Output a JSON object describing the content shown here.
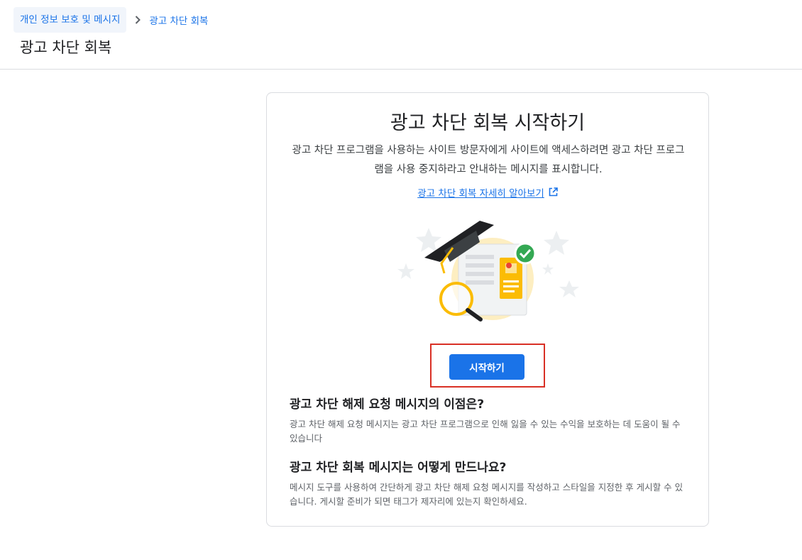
{
  "breadcrumb": {
    "parent": "개인 정보 보호 및 메시지",
    "current": "광고 차단 회복",
    "separator_icon": "chevron-right-icon"
  },
  "page": {
    "title": "광고 차단 회복"
  },
  "card": {
    "title": "광고 차단 회복 시작하기",
    "description": "광고 차단 프로그램을 사용하는 사이트 방문자에게 사이트에 액세스하려면 광고 차단 프로그램을 사용 중지하라고 안내하는 메시지를 표시합니다.",
    "learn_more": "광고 차단 회복 자세히 알아보기",
    "learn_more_icon": "open-in-new-icon",
    "illustration_icon": "graduation-cap-document-illustration",
    "start_button": "시작하기",
    "faq": [
      {
        "question": "광고 차단 해제 요청 메시지의 이점은?",
        "answer": "광고 차단 해제 요청 메시지는 광고 차단 프로그램으로 인해 잃을 수 있는 수익을 보호하는 데 도움이 될 수 있습니다"
      },
      {
        "question": "광고 차단 회복 메시지는 어떻게 만드나요?",
        "answer": "메시지 도구를 사용하여 간단하게 광고 차단 해제 요청 메시지를 작성하고 스타일을 지정한 후 게시할 수 있습니다. 게시할 준비가 되면 태그가 제자리에 있는지 확인하세요."
      }
    ]
  },
  "colors": {
    "accent": "#1a73e8",
    "highlight": "#d93025",
    "check": "#34a853",
    "illustration_yellow": "#fbbc04"
  }
}
